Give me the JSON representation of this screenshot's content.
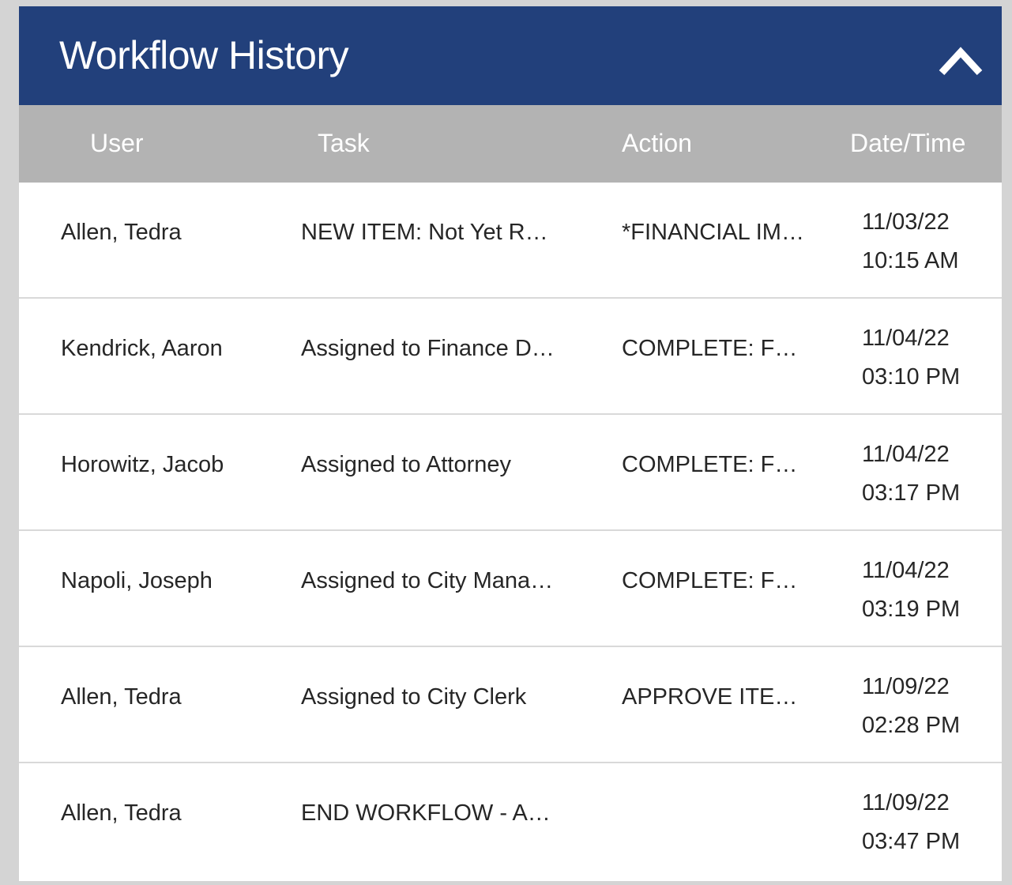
{
  "panel": {
    "title": "Workflow History",
    "collapse_icon": "chevron-up-icon"
  },
  "columns": {
    "user": "User",
    "task": "Task",
    "action": "Action",
    "datetime": "Date/Time"
  },
  "rows": [
    {
      "user": "Allen, Tedra",
      "task": "NEW ITEM: Not Yet R…",
      "action": "*FINANCIAL IM…",
      "date": "11/03/22",
      "time": "10:15 AM"
    },
    {
      "user": "Kendrick, Aaron",
      "task": "Assigned to Finance D…",
      "action": "COMPLETE: F…",
      "date": "11/04/22",
      "time": "03:10 PM"
    },
    {
      "user": "Horowitz, Jacob",
      "task": "Assigned to Attorney",
      "action": "COMPLETE: F…",
      "date": "11/04/22",
      "time": "03:17 PM"
    },
    {
      "user": "Napoli, Joseph",
      "task": "Assigned to City Mana…",
      "action": "COMPLETE: F…",
      "date": "11/04/22",
      "time": "03:19 PM"
    },
    {
      "user": "Allen, Tedra",
      "task": "Assigned to City Clerk",
      "action": "APPROVE ITE…",
      "date": "11/09/22",
      "time": "02:28 PM"
    },
    {
      "user": "Allen, Tedra",
      "task": "END WORKFLOW - A…",
      "action": "",
      "date": "11/09/22",
      "time": "03:47 PM"
    }
  ],
  "colors": {
    "header_bg": "#22407b",
    "column_header_bg": "#b3b3b3",
    "page_bg": "#d4d4d4"
  }
}
